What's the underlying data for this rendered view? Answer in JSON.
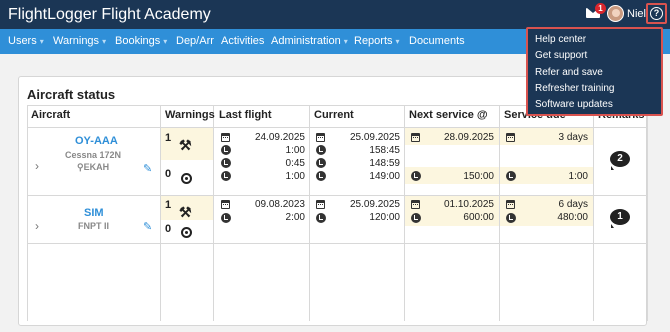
{
  "header": {
    "brand": "FlightLogger Flight Academy",
    "mail_badge": "1",
    "username": "Niel",
    "help_symbol": "?"
  },
  "nav": {
    "items": [
      {
        "label": "Users",
        "caret": true
      },
      {
        "label": "Warnings",
        "caret": true
      },
      {
        "label": "Bookings",
        "caret": true
      },
      {
        "label": "Dep/Arr",
        "caret": false
      },
      {
        "label": "Activities",
        "caret": false
      },
      {
        "label": "Administration",
        "caret": true
      },
      {
        "label": "Reports",
        "caret": true
      },
      {
        "label": "Documents",
        "caret": false
      }
    ]
  },
  "help_menu": {
    "items": [
      "Help center",
      "Get support",
      "Refer and save",
      "Refresher training",
      "Software updates"
    ]
  },
  "panel": {
    "title": "Aircraft status",
    "columns": [
      "Aircraft",
      "Warnings",
      "Last flight",
      "Current",
      "Next service @",
      "Service due",
      "Remarks"
    ]
  },
  "aircraft": [
    {
      "name": "OY-AAA",
      "model": "Cessna 172N",
      "location": "EKAH",
      "warn_maintenance": "1",
      "warn_tire": "0",
      "last_flight": [
        "24.09.2025",
        "1:00",
        "0:45",
        "1:00"
      ],
      "current": [
        "25.09.2025",
        "158:45",
        "148:59",
        "149:00"
      ],
      "next_service": [
        "28.09.2025",
        "150:00"
      ],
      "service_due": [
        "3 days",
        "1:00"
      ],
      "remarks": "2"
    },
    {
      "name": "SIM",
      "model": "FNPT II",
      "location": "",
      "warn_maintenance": "1",
      "warn_tire": "0",
      "last_flight": [
        "09.08.2023",
        "2:00"
      ],
      "current": [
        "25.09.2025",
        "120:00"
      ],
      "next_service": [
        "01.10.2025",
        "600:00"
      ],
      "service_due": [
        "6 days",
        "480:00"
      ],
      "remarks": "1"
    }
  ],
  "icons": {
    "mail": "envelope-icon",
    "help": "question-circle-icon",
    "calendar": "calendar-icon",
    "clock": "clock-icon",
    "wrench": "wrench-icon",
    "tire": "tire-icon",
    "pencil": "pencil-icon",
    "pin": "map-pin-icon",
    "chevron": "chevron-right-icon",
    "comment": "comment-icon"
  },
  "colors": {
    "topbar": "#1b3655",
    "navbar": "#2f8fd8",
    "highlight_border": "#d9534f",
    "cream": "#fcf6df",
    "link": "#2f8fd8"
  }
}
